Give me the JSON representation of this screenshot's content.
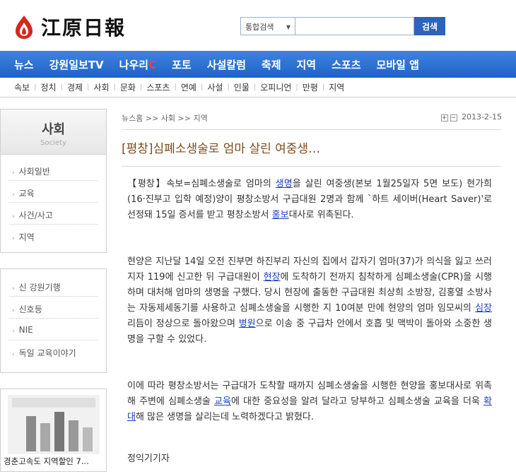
{
  "header": {
    "logo_text": "江原日報",
    "search_scope": "통합검색",
    "search_value": "",
    "search_button": "검색"
  },
  "main_nav": [
    {
      "label": "뉴스"
    },
    {
      "label": "강원일보TV"
    },
    {
      "label": "나우리",
      "accent": "C"
    },
    {
      "label": "포토"
    },
    {
      "label": "사설칼럼"
    },
    {
      "label": "축제"
    },
    {
      "label": "지역"
    },
    {
      "label": "스포츠"
    },
    {
      "label": "모바일 앱"
    }
  ],
  "sub_nav": [
    "속보",
    "정치",
    "경제",
    "사회",
    "문화",
    "스포츠",
    "연예",
    "사설",
    "인물",
    "오피니언",
    "만평",
    "지역"
  ],
  "sidebar": {
    "section_title": "사회",
    "section_subtitle": "Society",
    "menu": [
      "사회일반",
      "교육",
      "사건/사고",
      "지역"
    ],
    "menu2": [
      "신 강원기행",
      "신호등",
      "NIE",
      "독일 교육이야기"
    ],
    "promo_caption": "경춘고속도 지역할인 7..."
  },
  "article": {
    "breadcrumb": "뉴스홈 >> 사회 >> 지역",
    "date": "2013-2-15",
    "headline": "[평창]심폐소생술로 엄마 살린 여중생…",
    "p1": {
      "a": "【평창】속보=심폐소생술로 엄마의 ",
      "l1": "생명",
      "b": "을 살린 여중생(본보 1월25일자 5면 보도) 현가희(16·진부고 입학 예정)양이 평창소방서 구급대원 2명과 함께 `하트 세이버(Heart Saver)'로 선정돼 15일 증서를 받고 평창소방서 ",
      "l2": "홍보",
      "c": "대사로 위촉된다."
    },
    "p2": {
      "a": "현양은 지난달 14일 오전 진부면 하진부리 자신의 집에서 갑자기 엄마(37)가 의식을 잃고 쓰러지자 119에 신고한 뒤 구급대원이 ",
      "l1": "현장",
      "b": "에 도착하기 전까지 침착하게 심폐소생술(CPR)을 시행하며 대처해 엄마의 생명을 구했다. 당시 현장에 출동한 구급대원 최상희 소방장, 김홍열 소방사는 자동제세동기를 사용하고 심폐소생술을 시행한 지 10여분 만에 현양의 엄마 임모씨의 ",
      "l2": "심장",
      "c": " 리듬이 정상으로 돌아왔으며 ",
      "l3": "병원",
      "d": "으로 이송 중 구급차 안에서 호흡 및 맥박이 돌아와 소중한 생명을 구할 수 있었다."
    },
    "p3": {
      "a": "이에 따라 평창소방서는 구급대가 도착할 때까지 심폐소생술을 시행한 현양을 홍보대사로 위촉해 주변에 심폐소생술 ",
      "l1": "교육",
      "b": "에 대한 중요성을 알려 달라고 당부하고 심폐소생술 교육을 더욱 ",
      "l2": "확대",
      "c": "해 많은 생명을 살리는데 노력하겠다고 밝혔다."
    },
    "byline": "정익기기자"
  },
  "colors": {
    "nav_blue": "#2a6fd1",
    "headline_brown": "#7b4c1e",
    "link_blue": "#1f3fbf"
  }
}
